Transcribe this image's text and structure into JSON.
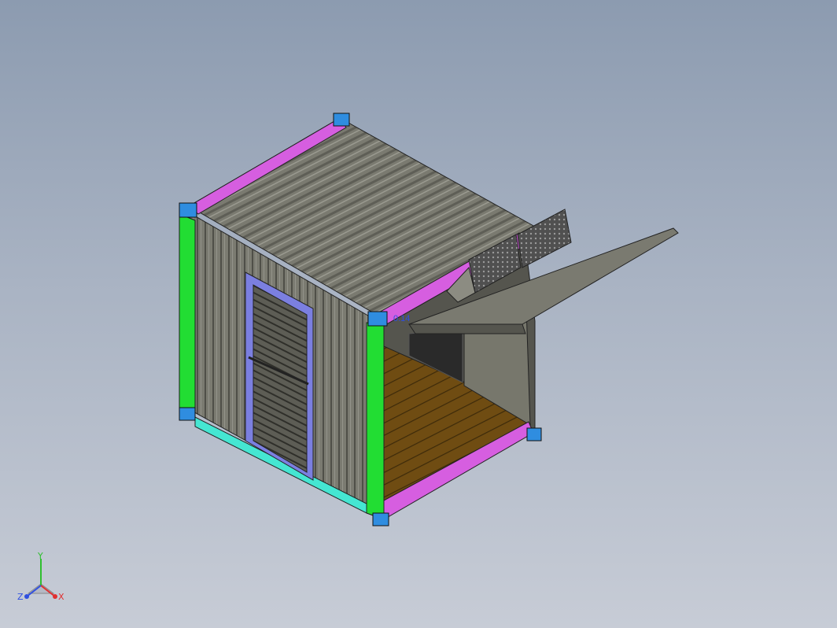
{
  "viewport": {
    "background_top": "#8c9bb0",
    "background_bottom": "#c7ccd6"
  },
  "model": {
    "parts": [
      {
        "name": "corner-post",
        "color": "#22dd33"
      },
      {
        "name": "top-rail",
        "color": "#d65ee0"
      },
      {
        "name": "bottom-rail",
        "color": "#45e6d2"
      },
      {
        "name": "corner-casting",
        "color": "#2f8de0"
      },
      {
        "name": "corrugated-panel",
        "color": "#76766c"
      },
      {
        "name": "floor",
        "color": "#6b4a12"
      },
      {
        "name": "door",
        "color": "#5c5c54"
      },
      {
        "name": "door-frame",
        "color": "#7b7fe0"
      }
    ],
    "label_text": "0.14"
  },
  "triad": {
    "x_label": "X",
    "y_label": "Y",
    "z_label": "Z",
    "x_color": "#e03030",
    "y_color": "#2fbf2f",
    "z_color": "#2f4fe0"
  }
}
